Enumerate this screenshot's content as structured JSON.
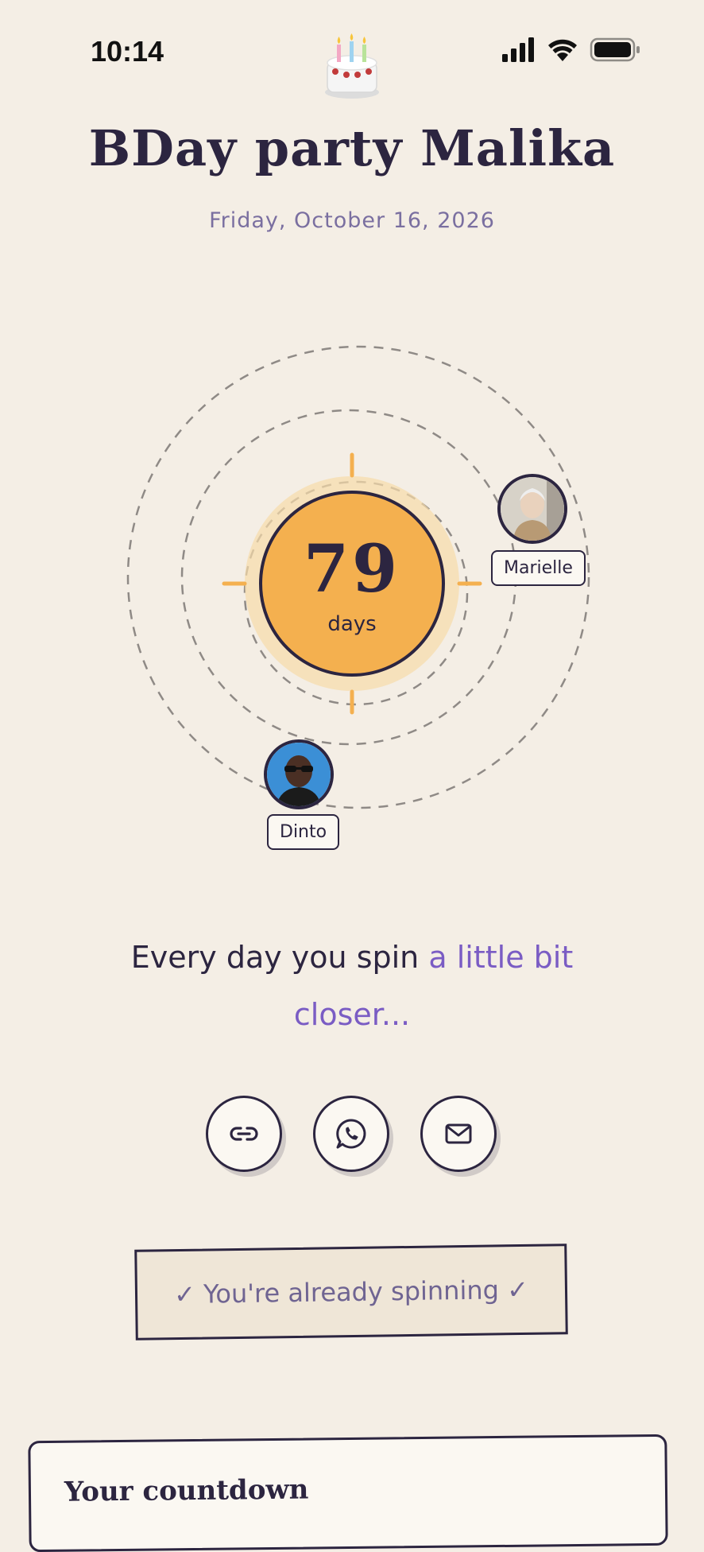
{
  "status_bar": {
    "time": "10:14"
  },
  "event": {
    "title": "BDay party Malika",
    "date": "Friday, October 16, 2026"
  },
  "countdown": {
    "value": "79",
    "unit": "days"
  },
  "participants": [
    {
      "name": "Marielle"
    },
    {
      "name": "Dinto"
    }
  ],
  "tagline": {
    "part1": "Every day you spin ",
    "accent": "a little bit closer..."
  },
  "share": {
    "link_icon": "link-icon",
    "whatsapp_icon": "whatsapp-icon",
    "mail_icon": "mail-icon"
  },
  "status_message": "✓ You're already spinning ✓",
  "countdown_section": {
    "title": "Your countdown"
  },
  "colors": {
    "background": "#f4eee5",
    "sun": "#f4b04f",
    "ink": "#2c2540",
    "accent": "#7a5cc4"
  }
}
